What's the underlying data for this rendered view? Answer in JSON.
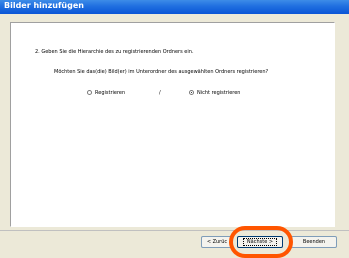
{
  "window": {
    "title": "Bilder hinzufügen"
  },
  "content": {
    "step_text": "2. Geben Sie die Hierarchie des zu registrierenden Ordners ein.",
    "question": "Möchten Sie das(die) Bild(er) im Unterordner des ausgewählten Ordners registrieren?",
    "separator": "/",
    "options": [
      {
        "label": "Registrieren",
        "selected": false
      },
      {
        "label": "Nicht registrieren",
        "selected": true
      }
    ]
  },
  "buttons": {
    "back": "< Zurüc",
    "next": "Nächste >",
    "finish": "Beenden"
  },
  "colors": {
    "titlebar": "#0a55d6",
    "highlight_circle": "#ff5500"
  }
}
